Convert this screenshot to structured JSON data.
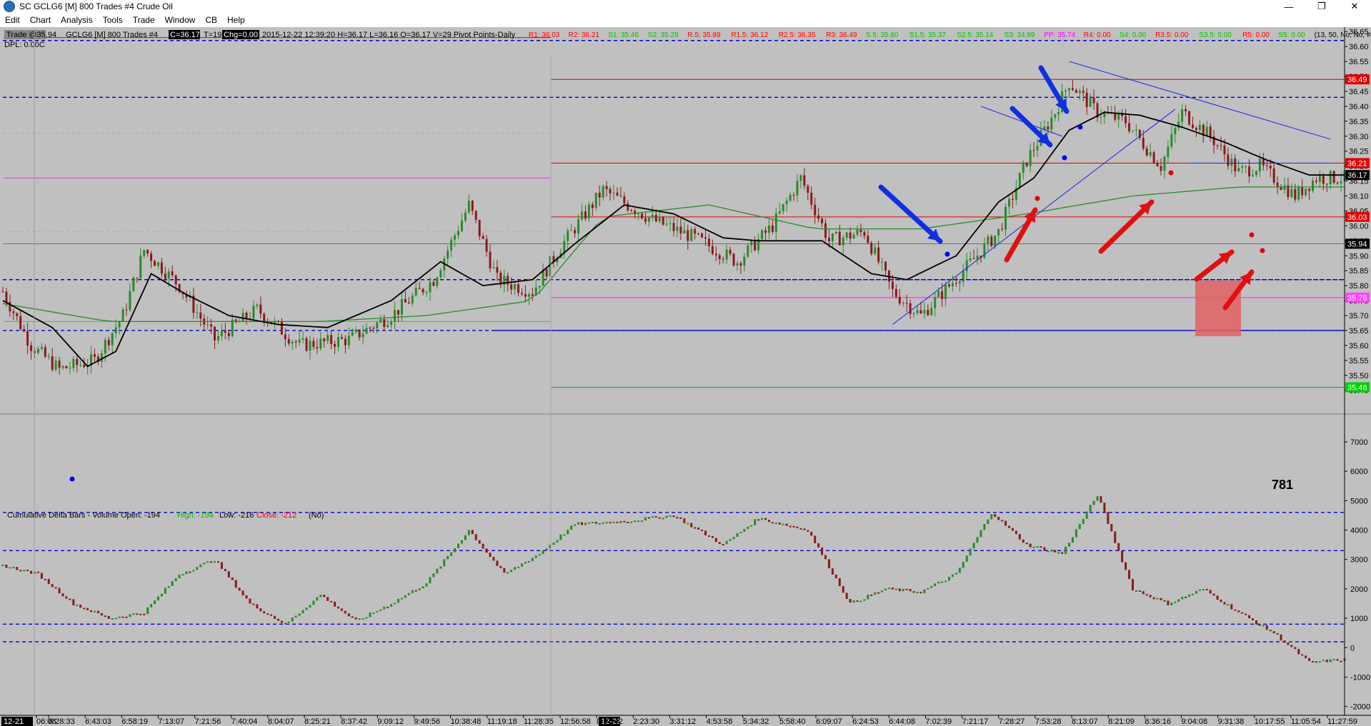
{
  "window": {
    "title": "SC GCLG6 [M]  800 Trades #4  Crude Oil",
    "controls": [
      "—",
      "❐",
      "✕"
    ]
  },
  "menu": [
    "Edit",
    "Chart",
    "Analysis",
    "Tools",
    "Trade",
    "Window",
    "CB",
    "Help"
  ],
  "info_bar": {
    "trade_box": "Trade  @35.94",
    "symbol": "GCLG6 [M]  800 Trades #4",
    "c_box": "C=36.17",
    "t": "T=19",
    "chg_box": "Chg=0.00",
    "ohlc": "2015-12-22  12:39:20  H=36.17  L=36.16  O=36.17  V=29  Pivot Points-Daily",
    "dpl": "DPL: 0.00C",
    "pivots": [
      {
        "text": "R1: 36.03",
        "color": "#ff0000"
      },
      {
        "text": "R2: 36.21",
        "color": "#ff0000"
      },
      {
        "text": "S1: 35.46",
        "color": "#00c000"
      },
      {
        "text": "S2: 35.28",
        "color": "#00c000"
      },
      {
        "text": "R.5: 35.89",
        "color": "#ff0000"
      },
      {
        "text": "R1.5: 36.12",
        "color": "#ff0000"
      },
      {
        "text": "R2.5: 36.35",
        "color": "#ff0000"
      },
      {
        "text": "R3: 36.49",
        "color": "#ff0000"
      },
      {
        "text": "S.5: 35.60",
        "color": "#00c000"
      },
      {
        "text": "S1.5: 35.37",
        "color": "#00c000"
      },
      {
        "text": "S2.5: 35.14",
        "color": "#00c000"
      },
      {
        "text": "S3: 34.99",
        "color": "#00c000"
      },
      {
        "text": "PP: 35.74",
        "color": "#ff00ff"
      },
      {
        "text": "R4: 0.00",
        "color": "#ff0000"
      },
      {
        "text": "S4: 0.00",
        "color": "#00c000"
      },
      {
        "text": "R3.5: 0.00",
        "color": "#ff0000"
      },
      {
        "text": "S3.5: 0.00",
        "color": "#00c000"
      },
      {
        "text": "R5: 0.00",
        "color": "#ff0000"
      },
      {
        "text": "S5: 0.00",
        "color": "#00c000"
      },
      {
        "text": "(13, 50, No, No, #1, No, N",
        "color": "#000000"
      }
    ]
  },
  "annotation_781": "781",
  "lower_panel_header": {
    "prefix": "Cumulative Delta Bars - Volume  Open: -194",
    "high": "High: -194",
    "low": "Low: -216",
    "close": "Close: -212",
    "suffix": "(No)"
  },
  "chart_data": [
    {
      "type": "candlestick",
      "instrument": "GCLG6 [M] 800 Trades #4 Crude Oil",
      "ylim": [
        35.38,
        36.66
      ],
      "y_ticks": [
        36.65,
        36.6,
        36.55,
        36.5,
        36.45,
        36.4,
        36.35,
        36.3,
        36.25,
        36.2,
        36.15,
        36.1,
        36.05,
        36.0,
        35.95,
        35.9,
        35.85,
        35.8,
        35.75,
        35.7,
        35.65,
        35.6,
        35.55,
        35.5,
        35.45
      ],
      "y_tick_labels": [
        "36.65",
        "36.60",
        "36.55",
        "36.50",
        "36.45",
        "36.40",
        "36.35",
        "36.30",
        "36.25",
        "36.20",
        "36.15",
        "36.10",
        "36.05",
        "36.00",
        "35.95",
        "35.90",
        "35.85",
        "35.80",
        "35.75",
        "35.70",
        "35.65",
        "35.60",
        "35.55",
        "35.50",
        "35.45"
      ],
      "x_tick_labels": [
        "06:08",
        "6:28:33",
        "6:43:03",
        "6:58:19",
        "7:13:07",
        "7:21:56",
        "7:40:04",
        "8:04:07",
        "8:25:21",
        "8:37:42",
        "9:09:12",
        "9:49:56",
        "10:38:48",
        "11:19:18",
        "11:28:35",
        "12:56:58",
        "0:37:42",
        "2:23:30",
        "3:31:12",
        "4:53:58",
        "5:34:32",
        "5:58:40",
        "6:09:07",
        "6:24:53",
        "6:44:08",
        "7:02:39",
        "7:21:17",
        "7:28:27",
        "7:53:28",
        "8:13:07",
        "8:21:09",
        "8:36:16",
        "9:04:08",
        "9:31:38",
        "10:17:55",
        "11:05:54",
        "11:27:59"
      ],
      "date_markers": [
        "12-21",
        "12-22"
      ],
      "close_path": [
        [
          0,
          35.78
        ],
        [
          8,
          35.6
        ],
        [
          16,
          35.52
        ],
        [
          26,
          35.55
        ],
        [
          34,
          35.7
        ],
        [
          40,
          35.92
        ],
        [
          50,
          35.8
        ],
        [
          60,
          35.62
        ],
        [
          72,
          35.72
        ],
        [
          84,
          35.6
        ],
        [
          98,
          35.62
        ],
        [
          110,
          35.7
        ],
        [
          122,
          35.82
        ],
        [
          132,
          36.07
        ],
        [
          140,
          35.82
        ],
        [
          150,
          35.78
        ],
        [
          158,
          35.93
        ],
        [
          170,
          36.12
        ],
        [
          184,
          36.02
        ],
        [
          196,
          35.96
        ],
        [
          208,
          35.88
        ],
        [
          218,
          36.0
        ],
        [
          226,
          36.16
        ],
        [
          234,
          35.95
        ],
        [
          244,
          35.98
        ],
        [
          252,
          35.78
        ],
        [
          260,
          35.7
        ],
        [
          272,
          35.85
        ],
        [
          282,
          35.98
        ],
        [
          290,
          36.22
        ],
        [
          298,
          36.38
        ],
        [
          302,
          36.48
        ],
        [
          310,
          36.38
        ],
        [
          318,
          36.35
        ],
        [
          328,
          36.2
        ],
        [
          334,
          36.38
        ],
        [
          342,
          36.3
        ],
        [
          350,
          36.18
        ],
        [
          356,
          36.2
        ],
        [
          366,
          36.1
        ],
        [
          372,
          36.16
        ],
        [
          380,
          36.16
        ]
      ],
      "ema_black_path": [
        [
          0,
          35.75
        ],
        [
          14,
          35.66
        ],
        [
          24,
          35.53
        ],
        [
          32,
          35.58
        ],
        [
          42,
          35.84
        ],
        [
          52,
          35.77
        ],
        [
          64,
          35.7
        ],
        [
          78,
          35.67
        ],
        [
          92,
          35.66
        ],
        [
          110,
          35.75
        ],
        [
          124,
          35.88
        ],
        [
          136,
          35.8
        ],
        [
          150,
          35.82
        ],
        [
          162,
          35.94
        ],
        [
          176,
          36.07
        ],
        [
          190,
          36.04
        ],
        [
          204,
          35.96
        ],
        [
          214,
          35.95
        ],
        [
          232,
          35.95
        ],
        [
          246,
          35.84
        ],
        [
          256,
          35.82
        ],
        [
          270,
          35.9
        ],
        [
          282,
          36.08
        ],
        [
          292,
          36.16
        ],
        [
          302,
          36.32
        ],
        [
          312,
          36.38
        ],
        [
          322,
          36.37
        ],
        [
          334,
          36.33
        ],
        [
          346,
          36.28
        ],
        [
          358,
          36.22
        ],
        [
          370,
          36.17
        ],
        [
          380,
          36.17
        ]
      ],
      "sma_green_path": [
        [
          0,
          35.74
        ],
        [
          30,
          35.68
        ],
        [
          60,
          35.68
        ],
        [
          90,
          35.68
        ],
        [
          120,
          35.7
        ],
        [
          150,
          35.75
        ],
        [
          170,
          36.03
        ],
        [
          200,
          36.07
        ],
        [
          230,
          35.99
        ],
        [
          260,
          35.99
        ],
        [
          290,
          36.04
        ],
        [
          320,
          36.1
        ],
        [
          350,
          36.13
        ],
        [
          380,
          36.13
        ]
      ],
      "horizontal_levels": [
        {
          "value": 36.62,
          "style": "blue-dash"
        },
        {
          "value": 36.43,
          "style": "blue-dash"
        },
        {
          "value": 36.49,
          "style": "red",
          "label": "36.49"
        },
        {
          "value": 36.21,
          "style": "red",
          "label": "36.21"
        },
        {
          "value": 36.03,
          "style": "red",
          "label": "36.03"
        },
        {
          "value": 36.17,
          "style": "last",
          "label": "36.17"
        },
        {
          "value": 35.94,
          "style": "gray",
          "label": "35.94"
        },
        {
          "value": 35.82,
          "style": "blue-dash"
        },
        {
          "value": 35.76,
          "style": "magenta",
          "label": "35.76"
        },
        {
          "value": 35.65,
          "style": "blue-dash"
        },
        {
          "value": 35.46,
          "style": "green",
          "label": "35.46"
        }
      ]
    },
    {
      "type": "bar",
      "title": "Cumulative Delta Bars - Volume",
      "open": -194,
      "high": -194,
      "low": -216,
      "close": -212,
      "ylim": [
        -2300,
        7800
      ],
      "y_ticks": [
        7000,
        6000,
        5000,
        4000,
        3000,
        2000,
        1000,
        0,
        -1000,
        -2000
      ],
      "y_tick_labels": [
        "7000",
        "6000",
        "5000",
        "4000",
        "3000",
        "2000",
        "1000",
        "0",
        "-1000",
        "-2000"
      ],
      "path": [
        [
          0,
          2800
        ],
        [
          10,
          2500
        ],
        [
          20,
          1500
        ],
        [
          30,
          1000
        ],
        [
          40,
          1200
        ],
        [
          50,
          2500
        ],
        [
          60,
          3000
        ],
        [
          70,
          1500
        ],
        [
          80,
          800
        ],
        [
          90,
          1800
        ],
        [
          100,
          900
        ],
        [
          110,
          1500
        ],
        [
          120,
          2200
        ],
        [
          132,
          4000
        ],
        [
          142,
          2500
        ],
        [
          152,
          3200
        ],
        [
          162,
          4200
        ],
        [
          176,
          4300
        ],
        [
          190,
          4500
        ],
        [
          204,
          3500
        ],
        [
          214,
          4400
        ],
        [
          228,
          4000
        ],
        [
          240,
          1500
        ],
        [
          250,
          2000
        ],
        [
          260,
          1900
        ],
        [
          270,
          2500
        ],
        [
          280,
          4600
        ],
        [
          290,
          3500
        ],
        [
          300,
          3200
        ],
        [
          310,
          5200
        ],
        [
          320,
          2000
        ],
        [
          330,
          1500
        ],
        [
          340,
          2000
        ],
        [
          350,
          1200
        ],
        [
          360,
          500
        ],
        [
          370,
          -500
        ],
        [
          380,
          -400
        ]
      ],
      "dashed_levels": [
        3300,
        4600,
        800,
        200
      ]
    }
  ]
}
